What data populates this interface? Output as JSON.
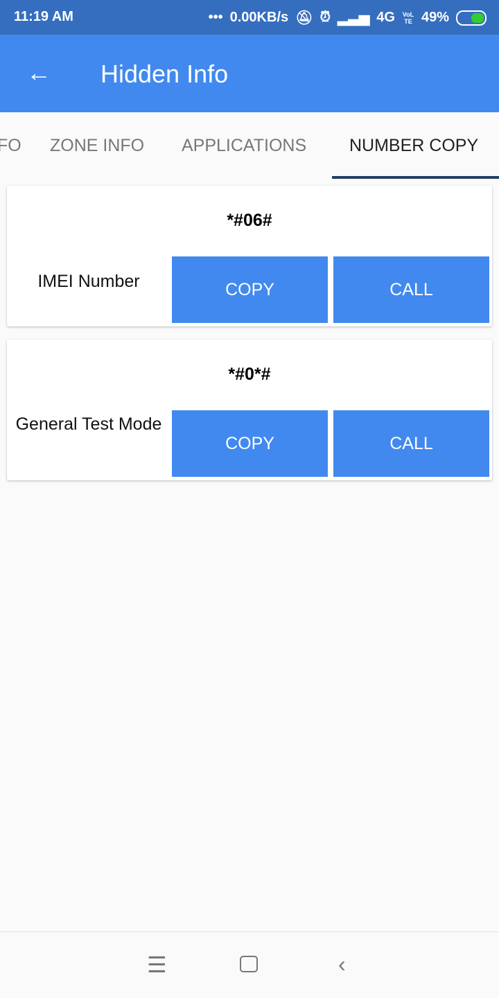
{
  "status_bar": {
    "time": "11:19 AM",
    "dots": "•••",
    "net_speed": "0.00KB/s",
    "network": "4G",
    "volte": "VoLTE",
    "battery": "49%"
  },
  "app_bar": {
    "back_icon": "arrow-left",
    "title": "Hidden Info"
  },
  "tabs": [
    {
      "label": "FO"
    },
    {
      "label": "ZONE INFO"
    },
    {
      "label": "APPLICATIONS"
    },
    {
      "label": "NUMBER COPY",
      "active": true
    }
  ],
  "cards": [
    {
      "code": "*#06#",
      "label": "IMEI Number",
      "copy": "COPY",
      "call": "CALL"
    },
    {
      "code": "*#0*#",
      "label": "General Test Mode",
      "copy": "COPY",
      "call": "CALL"
    }
  ],
  "colors": {
    "status_bar": "#356ebf",
    "app_bar": "#4189ee",
    "button": "#4189ee",
    "tab_indicator": "#233f61"
  }
}
